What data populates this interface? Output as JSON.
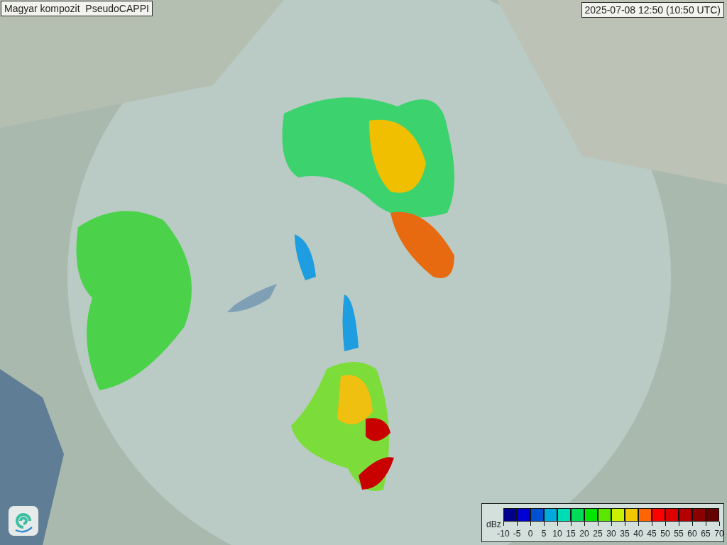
{
  "title": "Magyar kompozit  PseudoCAPPI",
  "timestamp": "2025-07-08 12:50 (10:50 UTC)",
  "legend": {
    "unit": "dBz",
    "swatches": [
      {
        "color": "#00008c"
      },
      {
        "color": "#0000d2"
      },
      {
        "color": "#0050d2"
      },
      {
        "color": "#00aadc"
      },
      {
        "color": "#00dcb4"
      },
      {
        "color": "#00dc5a"
      },
      {
        "color": "#00e600"
      },
      {
        "color": "#5ae600"
      },
      {
        "color": "#c8f000"
      },
      {
        "color": "#f0c800"
      },
      {
        "color": "#ff6400"
      },
      {
        "color": "#ff0000"
      },
      {
        "color": "#dc0000"
      },
      {
        "color": "#b40000"
      },
      {
        "color": "#8c0000"
      },
      {
        "color": "#640000"
      }
    ],
    "ticks": [
      "-10",
      "-5",
      "0",
      "5",
      "10",
      "15",
      "20",
      "25",
      "30",
      "35",
      "40",
      "45",
      "50",
      "55",
      "60",
      "65",
      "70"
    ]
  }
}
